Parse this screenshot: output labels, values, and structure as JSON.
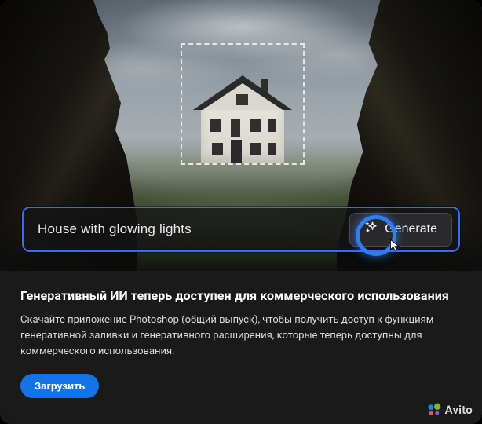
{
  "prompt": {
    "text": "House with glowing lights",
    "generate_label": "Generate"
  },
  "info": {
    "headline": "Генеративный ИИ теперь доступен для коммерческого использования",
    "body": "Скачайте приложение Photoshop (общий выпуск), чтобы получить доступ к функциям генеративной заливки и генеративного расширения, которые теперь доступны для коммерческого использования.",
    "download_label": "Загрузить"
  },
  "watermark": {
    "text": "Avito"
  }
}
